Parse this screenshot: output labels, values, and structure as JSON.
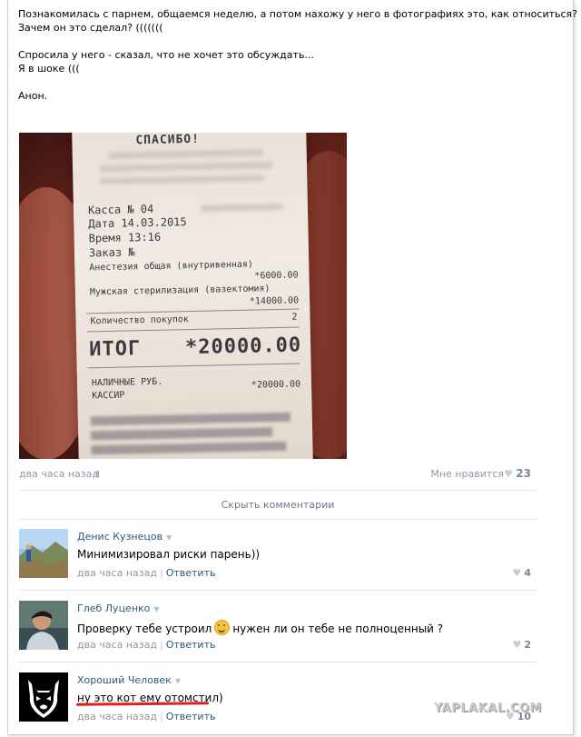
{
  "post": {
    "lines": [
      "Познакомилась с парнем, общаемся неделю, а потом нахожу у него в фотографиях это, как относиться?",
      "Зачем он это сделал? (((((((",
      "",
      "Спросила у него - сказал, что не хочет это обсуждать...",
      "Я в шоке (((",
      "",
      "Анон."
    ],
    "time": "два часа назад",
    "like_label": "Мне нравится",
    "like_count": "23"
  },
  "receipt": {
    "thanks": "СПАСИБО!",
    "kassa": "Касса № 04",
    "date": "Дата 14.03.2015",
    "time": "Время 13:16",
    "order": "Заказ №",
    "item1": "Анестезия общая (внутривенная)",
    "item1_price": "*6000.00",
    "item2": "Мужская стерилизация (вазектомия)",
    "item2_price": "*14000.00",
    "qty_label": "Количество покупок",
    "qty": "2",
    "total_label": "ИТОГ",
    "total_value": "*20000.00",
    "cash_label": "НАЛИЧНЫЕ РУБ.",
    "cash_value": "*20000.00",
    "cashier": "КАССИР"
  },
  "hide_comments": "Скрыть комментарии",
  "comments": [
    {
      "author": "Денис Кузнецов",
      "text": "Минимизировал риски парень))",
      "time": "два часа назад",
      "reply": "Ответить",
      "likes": "4"
    },
    {
      "author": "Глеб Луценко",
      "text_before": "Проверку тебе устроил",
      "text_after": "нужен ли он тебе не полноценный ?",
      "time": "два часа назад",
      "reply": "Ответить",
      "likes": "2"
    },
    {
      "author": "Хороший Человек",
      "text": "ну это кот ему отомстил)",
      "time": "два часа назад",
      "reply": "Ответить",
      "likes": "10"
    }
  ],
  "watermark": "YAPLAKAL.COM",
  "colors": {
    "link": "#2b587a",
    "meta": "#8f99a6",
    "underline": "#e02020"
  }
}
